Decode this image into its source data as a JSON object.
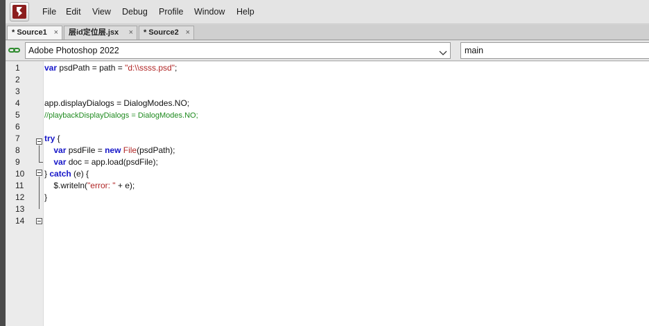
{
  "menubar": {
    "items": [
      "File",
      "Edit",
      "View",
      "Debug",
      "Profile",
      "Window",
      "Help"
    ]
  },
  "tabs": [
    {
      "label": "* Source1",
      "close": "×",
      "active": true
    },
    {
      "label": "层id定位层.jsx",
      "close": "×",
      "active": false
    },
    {
      "label": "* Source2",
      "close": "×",
      "active": false
    }
  ],
  "toolbar": {
    "target_app": "Adobe Photoshop 2022",
    "function": "main"
  },
  "editor": {
    "line_numbers": [
      "1",
      "2",
      "3",
      "4",
      "5",
      "6",
      "7",
      "8",
      "9",
      "10",
      "11",
      "12",
      "13",
      "14"
    ],
    "lines": [
      [
        {
          "t": "var",
          "c": "kw"
        },
        {
          "t": " psdPath = path = ",
          "c": "plain"
        },
        {
          "t": "\"d:\\\\ssss.psd\"",
          "c": "str"
        },
        {
          "t": ";",
          "c": "plain"
        }
      ],
      [],
      [],
      [
        {
          "t": "app.displayDialogs = DialogModes.NO;",
          "c": "plain"
        }
      ],
      [
        {
          "t": "//playbackDisplayDialogs = DialogModes.NO;",
          "c": "cmt"
        }
      ],
      [],
      [
        {
          "t": "try",
          "c": "kw"
        },
        {
          "t": " {",
          "c": "plain"
        }
      ],
      [
        {
          "t": "    ",
          "c": "plain"
        },
        {
          "t": "var",
          "c": "kw"
        },
        {
          "t": " psdFile = ",
          "c": "plain"
        },
        {
          "t": "new",
          "c": "kw"
        },
        {
          "t": " ",
          "c": "plain"
        },
        {
          "t": "File",
          "c": "cls"
        },
        {
          "t": "(psdPath);",
          "c": "plain"
        }
      ],
      [
        {
          "t": "    ",
          "c": "plain"
        },
        {
          "t": "var",
          "c": "kw"
        },
        {
          "t": " doc = app.load(psdFile);",
          "c": "plain"
        }
      ],
      [
        {
          "t": "} ",
          "c": "plain"
        },
        {
          "t": "catch",
          "c": "kw"
        },
        {
          "t": " (e) {",
          "c": "plain"
        }
      ],
      [
        {
          "t": "    $.writeln(",
          "c": "plain"
        },
        {
          "t": "\"error: \"",
          "c": "str"
        },
        {
          "t": " + e);",
          "c": "plain"
        }
      ],
      [
        {
          "t": "}",
          "c": "plain"
        }
      ],
      [],
      []
    ]
  },
  "colors": {
    "keyword": "#1515c8",
    "string": "#b02424",
    "comment": "#1e8a1e"
  }
}
